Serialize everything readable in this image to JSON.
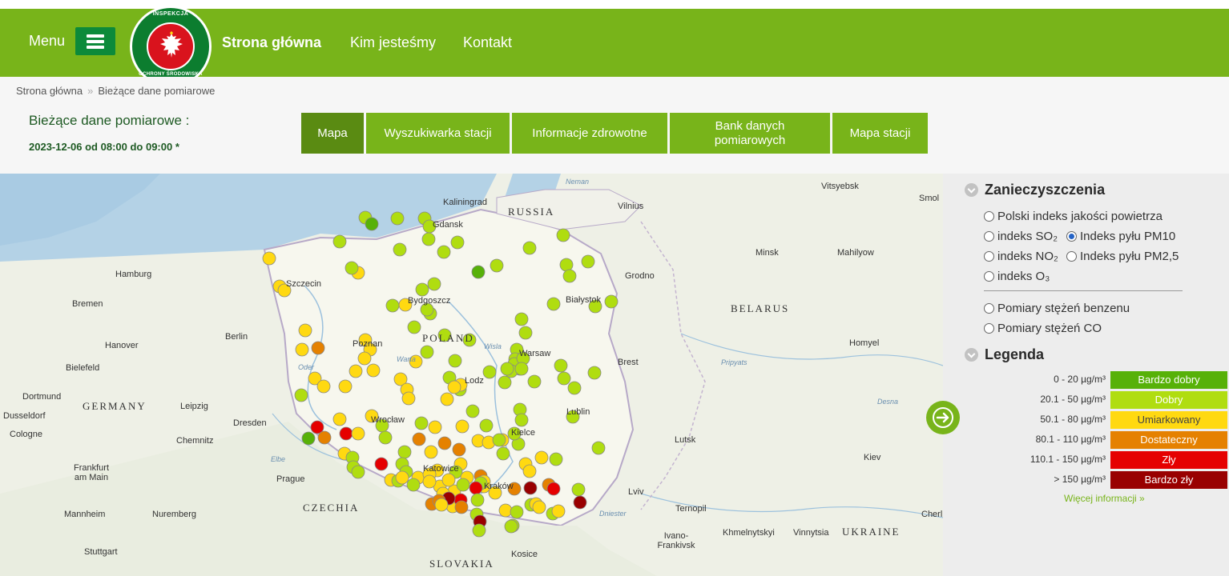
{
  "header": {
    "menu_label": "Menu",
    "logo_top": "INSPEKCJA",
    "logo_bottom": "OCHRONY ŚRODOWISKA",
    "nav": [
      "Strona główna",
      "Kim jesteśmy",
      "Kontakt"
    ]
  },
  "breadcrumb": {
    "home": "Strona główna",
    "sep": "»",
    "current": "Bieżące dane pomiarowe"
  },
  "page": {
    "title": "Bieżące dane pomiarowe :",
    "datetime": "2023-12-06 od 08:00 do 09:00 *"
  },
  "tabs": [
    "Mapa",
    "Wyszukiwarka stacji",
    "Informacje zdrowotne",
    "Bank danych pomiarowych",
    "Mapa stacji"
  ],
  "map": {
    "countries": [
      "RUSSIA",
      "BELARUS",
      "GERMANY",
      "POLAND",
      "CZECHIA",
      "UKRAINE",
      "SLOVAKIA"
    ],
    "cities": [
      "Kaliningrad",
      "Gdansk",
      "Vilnius",
      "Hamburg",
      "Szczecin",
      "Bremen",
      "Bydgoszcz",
      "Białystok",
      "Minsk",
      "Mahilyow",
      "Grodno",
      "Hanover",
      "Berlin",
      "Poznan",
      "Warsaw",
      "Brest",
      "Homyel",
      "Bielefeld",
      "Lodz",
      "Dortmund",
      "Leipzig",
      "Dresden",
      "Wrocław",
      "Lublin",
      "Cologne",
      "Chemnitz",
      "Kielce",
      "Lutsk",
      "Kiev",
      "Frankfurt am Main",
      "Prague",
      "Kraków",
      "Katowice",
      "Lviv",
      "Ternopil",
      "Mannheim",
      "Nuremberg",
      "Khmelnytskyi",
      "Vinnytsia",
      "Ivano-Frankivsk",
      "Stuttgart",
      "Kosice",
      "Dusseldorf",
      "Vitsyebsk",
      "Smol",
      "Cherl"
    ],
    "water": [
      "Neman",
      "Oder",
      "Warta",
      "Wisla",
      "Elbe",
      "Pripyats",
      "Desna",
      "Dniester"
    ],
    "legend_units": "µg/m³"
  },
  "pollutants": {
    "heading": "Zanieczyszczenia",
    "options": [
      {
        "label": "Polski indeks jakości powietrza",
        "selected": false
      },
      {
        "label": "indeks SO₂",
        "selected": false
      },
      {
        "label": "Indeks pyłu PM10",
        "selected": true
      },
      {
        "label": "indeks NO₂",
        "selected": false
      },
      {
        "label": "Indeks pyłu PM2,5",
        "selected": false
      },
      {
        "label": "indeks O₃",
        "selected": false
      },
      {
        "label": "Pomiary stężeń benzenu",
        "selected": false
      },
      {
        "label": "Pomiary stężeń CO",
        "selected": false
      }
    ]
  },
  "legend": {
    "heading": "Legenda",
    "items": [
      {
        "range": "0 - 20 µg/m³",
        "label": "Bardzo dobry",
        "color": "#57b108"
      },
      {
        "range": "20.1 - 50 µg/m³",
        "label": "Dobry",
        "color": "#b0dd10"
      },
      {
        "range": "50.1 - 80 µg/m³",
        "label": "Umiarkowany",
        "color": "#ffd911"
      },
      {
        "range": "80.1 - 110 µg/m³",
        "label": "Dostateczny",
        "color": "#e58100"
      },
      {
        "range": "110.1 - 150 µg/m³",
        "label": "Zły",
        "color": "#e50000"
      },
      {
        "range": "> 150 µg/m³",
        "label": "Bardzo zły",
        "color": "#990000"
      }
    ],
    "more_link": "Więcej informacji »"
  }
}
